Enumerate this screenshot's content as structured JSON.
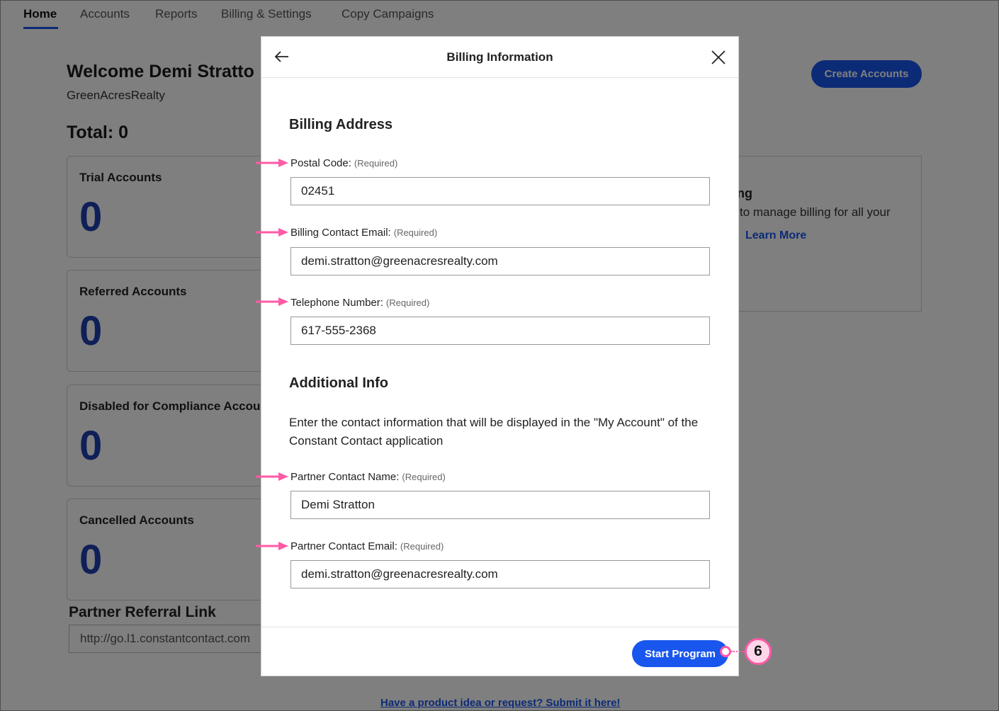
{
  "nav": {
    "tabs": [
      {
        "label": "Home",
        "active": true
      },
      {
        "label": "Accounts"
      },
      {
        "label": "Reports"
      },
      {
        "label": "Billing & Settings"
      },
      {
        "label": "Copy Campaigns"
      }
    ]
  },
  "dashboard": {
    "welcome": "Welcome Demi Stratto",
    "org": "GreenAcresRealty",
    "total": "Total: 0",
    "create_button": "Create Accounts",
    "cards": [
      {
        "label": "Trial Accounts",
        "value": "0"
      },
      {
        "label": "Referred Accounts",
        "value": "0"
      },
      {
        "label": "Disabled for Compliance Accou",
        "value": "0"
      },
      {
        "label": "Cancelled Accounts",
        "value": "0"
      }
    ],
    "info_card": {
      "title_fragment": "ng",
      "desc_fragment": "to manage billing for all your",
      "learn_more": "Learn More"
    },
    "referral": {
      "title": "Partner Referral Link",
      "value": "http://go.l1.constantcontact.com"
    },
    "footer_link": "Have a product idea or request? Submit it here!"
  },
  "modal": {
    "title": "Billing Information",
    "billing_section": "Billing Address",
    "additional_section": "Additional Info",
    "description": "Enter the contact information that will be displayed in the \"My Account\" of the Constant Contact application",
    "required_tag": "(Required)",
    "fields": [
      {
        "label": "Postal Code:",
        "value": "02451"
      },
      {
        "label": "Billing Contact Email:",
        "value": "demi.stratton@greenacresrealty.com"
      },
      {
        "label": "Telephone Number:",
        "value": "617-555-2368"
      },
      {
        "label": "Partner Contact Name:",
        "value": "Demi Stratton"
      },
      {
        "label": "Partner Contact Email:",
        "value": "demi.stratton@greenacresrealty.com"
      }
    ],
    "start_button": "Start Program",
    "step_number": "6"
  },
  "colors": {
    "accent": "#1856ed",
    "annotation": "#ff5aa6",
    "count": "#1f3fb0"
  }
}
